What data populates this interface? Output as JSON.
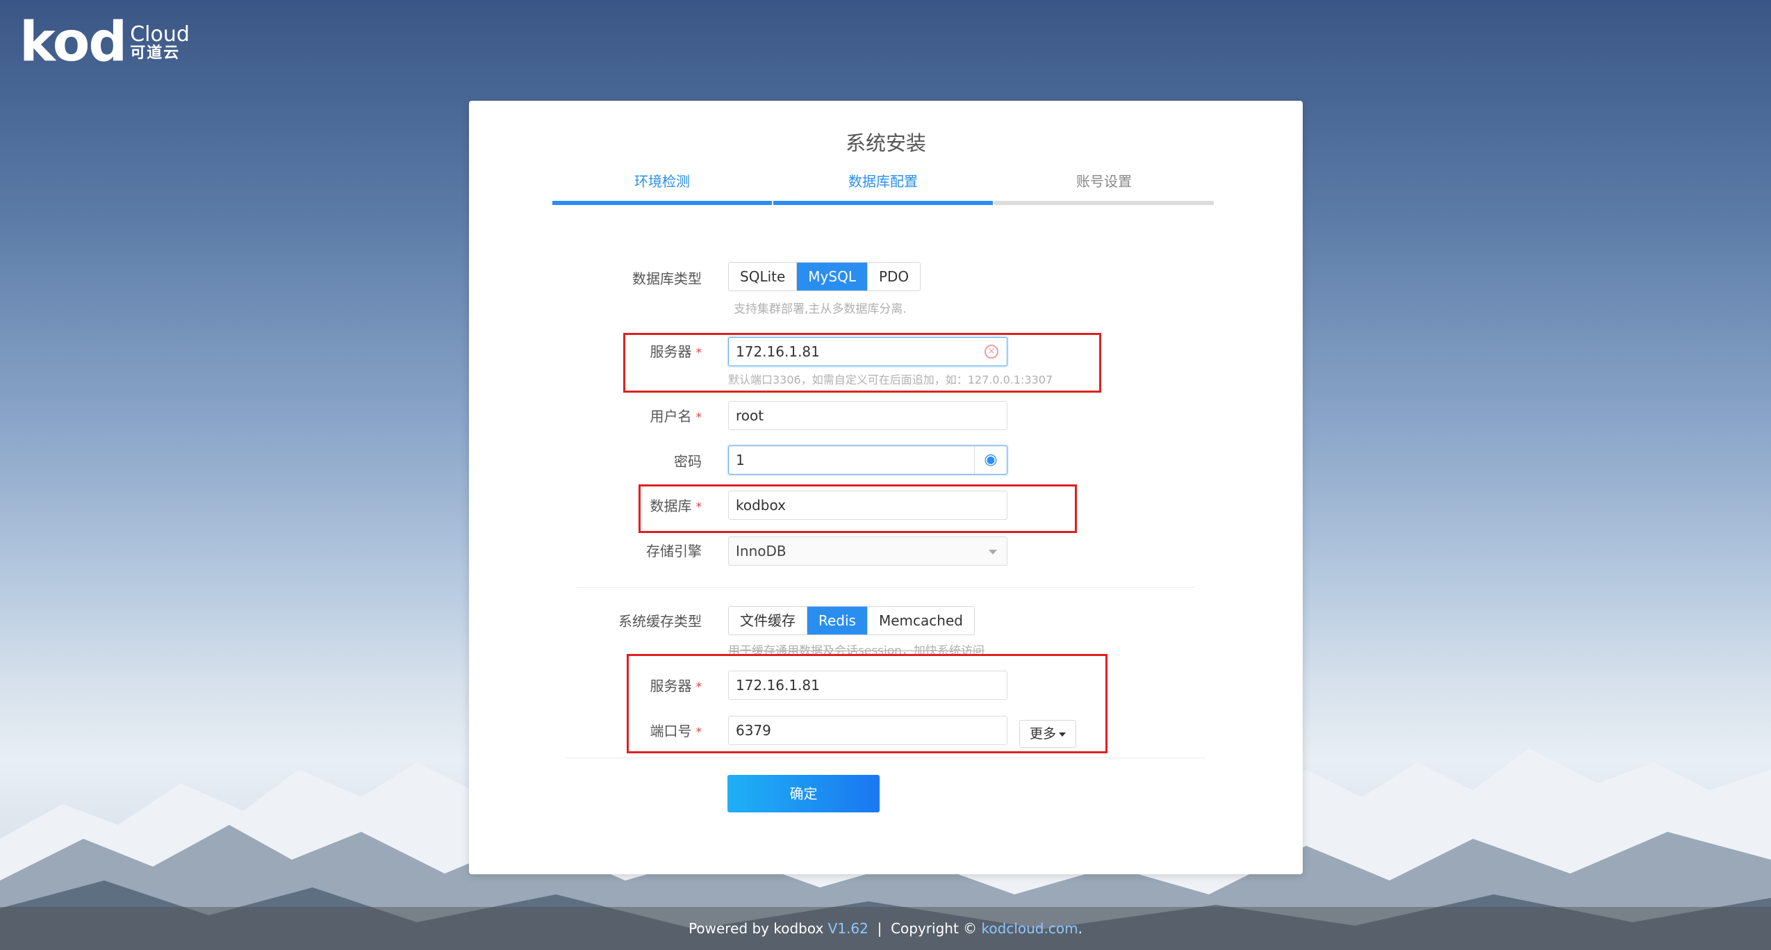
{
  "brand": {
    "logo_text": "kod",
    "cloud": "Cloud",
    "cn": "可道云"
  },
  "page": {
    "title": "系统安装"
  },
  "steps": [
    {
      "label": "环境检测",
      "state": "done"
    },
    {
      "label": "数据库配置",
      "state": "active"
    },
    {
      "label": "账号设置",
      "state": "todo"
    }
  ],
  "db": {
    "type_label": "数据库类型",
    "types": [
      "SQLite",
      "MySQL",
      "PDO"
    ],
    "selected_type": "MySQL",
    "type_hint": "支持集群部署,主从多数据库分离.",
    "server_label": "服务器",
    "server_value": "172.16.1.81",
    "server_hint": "默认端口3306，如需自定义可在后面追加，如：127.0.0.1:3307",
    "user_label": "用户名",
    "user_value": "root",
    "password_label": "密码",
    "password_value": "1",
    "database_label": "数据库",
    "database_value": "kodbox",
    "engine_label": "存储引擎",
    "engine_value": "InnoDB"
  },
  "cache": {
    "type_label": "系统缓存类型",
    "types": [
      "文件缓存",
      "Redis",
      "Memcached"
    ],
    "selected_type": "Redis",
    "type_hint": "用于缓存通用数据及会话session，加快系统访问",
    "server_label": "服务器",
    "server_value": "172.16.1.81",
    "port_label": "端口号",
    "port_value": "6379",
    "more_label": "更多"
  },
  "actions": {
    "submit": "确定"
  },
  "footer": {
    "powered": "Powered by kodbox",
    "version": "V1.62",
    "sep": "|",
    "copyright": "Copyright ©",
    "site": "kodcloud.com",
    "dot": "."
  },
  "colors": {
    "accent": "#2a8ef0",
    "required": "#e23c3c",
    "annotation": "#e02020"
  }
}
